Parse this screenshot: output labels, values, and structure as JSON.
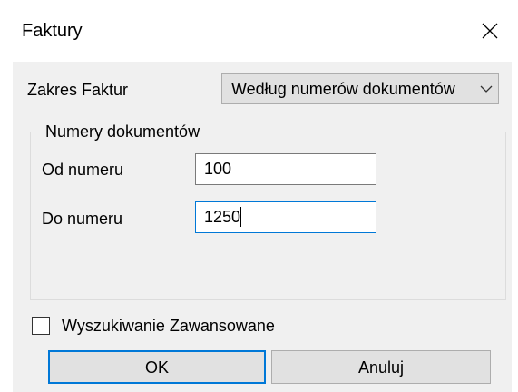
{
  "window": {
    "title": "Faktury",
    "close_icon": "close-icon"
  },
  "range": {
    "label": "Zakres Faktur",
    "selected": "Według numerów dokumentów",
    "arrow_icon": "chevron-down-icon"
  },
  "group": {
    "title": "Numery dokumentów",
    "from_label": "Od numeru",
    "from_value": "100",
    "to_label": "Do numeru",
    "to_value": "1250"
  },
  "advanced": {
    "label": "Wyszukiwanie Zawansowane",
    "checked": false
  },
  "buttons": {
    "ok": "OK",
    "cancel": "Anuluj"
  },
  "colors": {
    "focus_accent": "#0078d7",
    "dialog_background": "#f0f0f0",
    "button_face": "#e1e1e1"
  }
}
